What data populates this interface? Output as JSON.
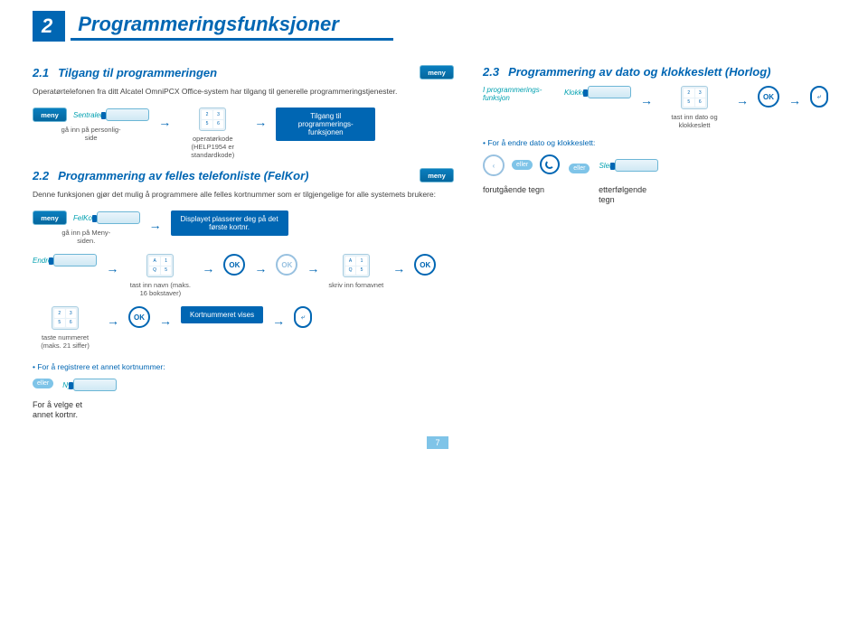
{
  "chapter": {
    "num": "2",
    "title": "Programmeringsfunksjoner"
  },
  "s21": {
    "num": "2.1",
    "title": "Tilgang til programmeringen",
    "meny": "meny",
    "intro": "Operatørtelefonen fra ditt Alcatel OmniPCX Office-system har tilgang til generelle programmeringstjenester.",
    "softkey_sentralen": "Sentralen",
    "step_personlig": "gå inn på personlig-side",
    "step_operatorkode": "operatørkode (HELP1954 er standardkode)",
    "banner_tilgang": "Tilgang til programmerings-funksjonen"
  },
  "s22": {
    "num": "2.2",
    "title": "Programmering av felles telefonliste (FelKor)",
    "meny": "meny",
    "intro": "Denne funksjonen gjør det mulig å programmere alle felles kortnummer som er tilgjengelige for alle systemets brukere:",
    "softkey_felkor": "FelKor",
    "banner_displayet": "Displayet plasserer deg på det første kortnr.",
    "step_meny_siden": "gå inn på Meny-siden.",
    "softkey_endre": "Endre",
    "step_navn": "tast inn navn (maks. 16 bokstaver)",
    "step_fornavn": "skriv inn fornavnet",
    "banner_kortnr": "Kortnummeret vises",
    "step_nummer": "taste nummeret (maks. 21 siffer)",
    "note_registrere": "For å registrere et annet kortnummer:",
    "softkey_ny": "Ny",
    "note_velge": "For å velge et annet kortnr.",
    "eller": "eller"
  },
  "s23": {
    "num": "2.3",
    "title": "Programmering av dato og klokkeslett (Horlog)",
    "softkey_prog": "I programmerings-funksjon",
    "softkey_klokke": "Klokke",
    "step_tastinn": "tast inn dato og klokkeslett",
    "note_endre": "For å endre dato og klokkeslett:",
    "softkey_slett": "Slett",
    "step_forut": "forutgående tegn",
    "step_etter": "etterfølgende tegn",
    "eller": "eller"
  },
  "page_num": "7"
}
